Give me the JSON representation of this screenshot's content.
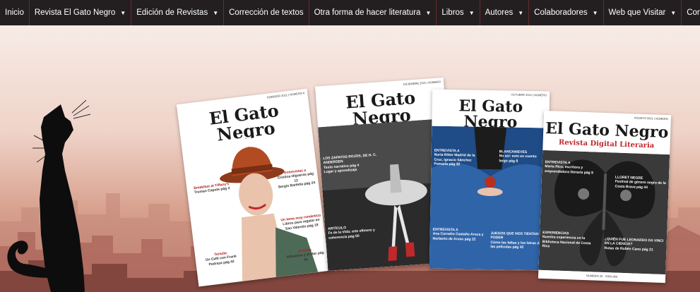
{
  "nav": {
    "items": [
      {
        "label": "Inicio",
        "has_dropdown": false
      },
      {
        "label": "Revista El Gato Negro",
        "has_dropdown": true
      },
      {
        "label": "Edición de Revistas",
        "has_dropdown": true
      },
      {
        "label": "Corrección de textos",
        "has_dropdown": false
      },
      {
        "label": "Otra forma de hacer literatura",
        "has_dropdown": true
      },
      {
        "label": "Libros",
        "has_dropdown": true
      },
      {
        "label": "Autores",
        "has_dropdown": true
      },
      {
        "label": "Colaboradores",
        "has_dropdown": true
      },
      {
        "label": "Web que Visitar",
        "has_dropdown": true
      },
      {
        "label": "Contacto",
        "has_dropdown": false
      }
    ],
    "caret": "▼"
  },
  "magazine": {
    "title": "El Gato Negro",
    "subtitle": "Revista Digital Literaria"
  },
  "covers": [
    {
      "date": "FEBRERO 2021 | NÚMERO 6",
      "blurbs": [
        "Breakfast at Tiffany's",
        "Truman Capote pág 4",
        "Entrevistas a",
        "Cristina Higueras pág 12",
        "Sergio Barletta pág 24",
        "Un tema muy romántico",
        "Libros para regalar en San Valentín pág 18",
        "Tertulia",
        "Un Café con Frank Pedraza pág 42",
        "Artículo",
        "Alhambra y el Mar pág 40"
      ]
    },
    {
      "date": "DICIEMBRE 2021 | NÚMERO",
      "blurbs": [
        "LOS ZAPATOS ROJOS, DE H. C. ANDERSEN",
        "Texto narrativo pág 4",
        "Lugar y aprendizaje",
        "ARTÍCULO",
        "Fe de la Vida: arte efímero y coherencia pág 50"
      ]
    },
    {
      "date": "OCTUBRE 2021 | NÚMERO",
      "blurbs": [
        "ENTREVISTA A",
        "Nuria Ritter Madrid de la Cruz, Ignacio Sánchez Pomarla pág 32",
        "BLANCANIEVES",
        "No así: esto es cuento largo pág 8",
        "ENTREVISTA A",
        "Ana Cornelio Castaño Aroca y Norberto de Arceo pág 22",
        "JUEGOS QUE NOS TIENTAN PODER",
        "Cómo las faltas y los letras de las películas pág 42"
      ]
    },
    {
      "date": "AGOSTO 2021 | NÚMERO",
      "blurbs": [
        "ENTREVISTA A",
        "Marta Rico, escritora y emprendedora literaria pág 9",
        "LLORET NEGRE",
        "Festival de género negro de la Costa Brava pág 44",
        "EXPERIENCIAS",
        "Nuestra experiencia en la Biblioteca Nacional de Costa Rica",
        "¿QUIÉN FUE LEONARDO DA VINCI EN LA CIENCIA?",
        "Rutas de Rubén Cano pág 21",
        "NÚMERO 25 · ISSN 000"
      ]
    }
  ],
  "colors": {
    "nav_bg": "#231f20",
    "nav_divider": "#6b2a2a",
    "accent_red": "#c0282b",
    "sky_top": "#f7ebe6",
    "city": "#b87261"
  },
  "icons": {
    "caret": "chevron-down-icon",
    "cat": "black-cat-silhouette"
  }
}
